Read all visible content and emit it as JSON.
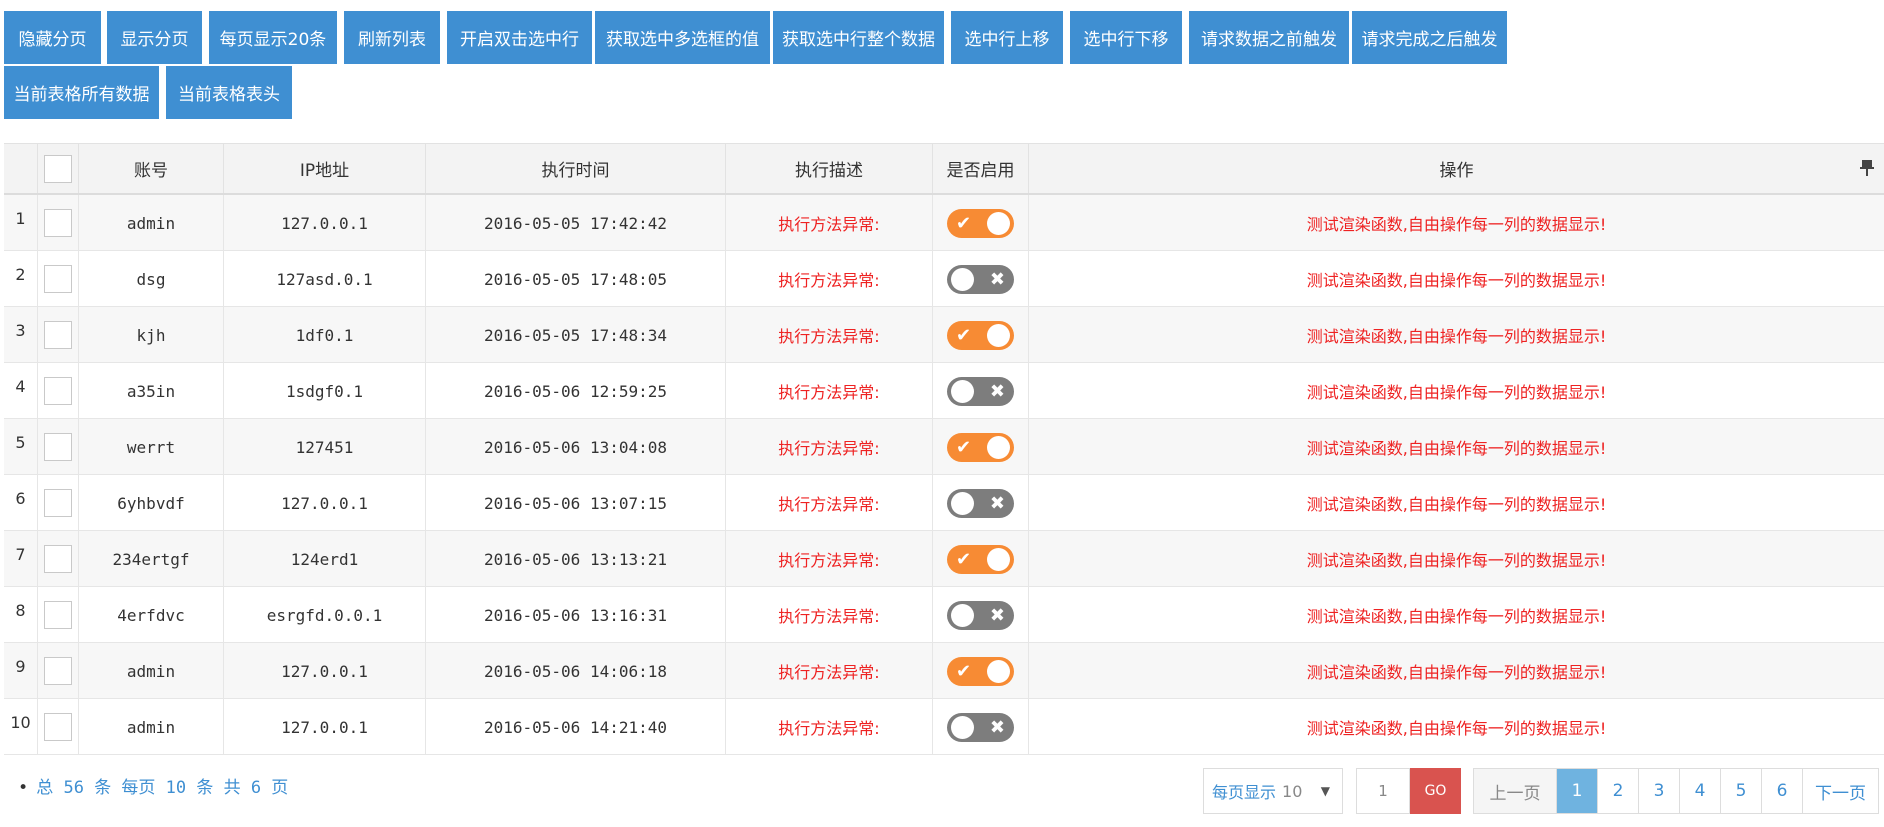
{
  "toolbar": {
    "buttons": [
      "隐藏分页",
      "显示分页",
      "每页显示20条",
      "刷新列表",
      "开启双击选中行",
      "获取选中多选框的值",
      "获取选中行整个数据",
      "选中行上移",
      "选中行下移",
      "请求数据之前触发",
      "请求完成之后触发",
      "当前表格所有数据",
      "当前表格表头"
    ]
  },
  "table": {
    "headers": [
      "账号",
      "IP地址",
      "执行时间",
      "执行描述",
      "是否启用",
      "操作"
    ],
    "rows": [
      {
        "index": "1",
        "account": "admin",
        "ip": "127.0.0.1",
        "time": "2016-05-05 17:42:42",
        "desc": "执行方法异常:",
        "enabled": true,
        "op": "测试渲染函数,自由操作每一列的数据显示!"
      },
      {
        "index": "2",
        "account": "dsg",
        "ip": "127asd.0.1",
        "time": "2016-05-05 17:48:05",
        "desc": "执行方法异常:",
        "enabled": false,
        "op": "测试渲染函数,自由操作每一列的数据显示!"
      },
      {
        "index": "3",
        "account": "kjh",
        "ip": "1df0.1",
        "time": "2016-05-05 17:48:34",
        "desc": "执行方法异常:",
        "enabled": true,
        "op": "测试渲染函数,自由操作每一列的数据显示!"
      },
      {
        "index": "4",
        "account": "a35in",
        "ip": "1sdgf0.1",
        "time": "2016-05-06 12:59:25",
        "desc": "执行方法异常:",
        "enabled": false,
        "op": "测试渲染函数,自由操作每一列的数据显示!"
      },
      {
        "index": "5",
        "account": "werrt",
        "ip": "127451",
        "time": "2016-05-06 13:04:08",
        "desc": "执行方法异常:",
        "enabled": true,
        "op": "测试渲染函数,自由操作每一列的数据显示!"
      },
      {
        "index": "6",
        "account": "6yhbvdf",
        "ip": "127.0.0.1",
        "time": "2016-05-06 13:07:15",
        "desc": "执行方法异常:",
        "enabled": false,
        "op": "测试渲染函数,自由操作每一列的数据显示!"
      },
      {
        "index": "7",
        "account": "234ertgf",
        "ip": "124erd1",
        "time": "2016-05-06 13:13:21",
        "desc": "执行方法异常:",
        "enabled": true,
        "op": "测试渲染函数,自由操作每一列的数据显示!"
      },
      {
        "index": "8",
        "account": "4erfdvc",
        "ip": "esrgfd.0.0.1",
        "time": "2016-05-06 13:16:31",
        "desc": "执行方法异常:",
        "enabled": false,
        "op": "测试渲染函数,自由操作每一列的数据显示!"
      },
      {
        "index": "9",
        "account": "admin",
        "ip": "127.0.0.1",
        "time": "2016-05-06 14:06:18",
        "desc": "执行方法异常:",
        "enabled": true,
        "op": "测试渲染函数,自由操作每一列的数据显示!"
      },
      {
        "index": "10",
        "account": "admin",
        "ip": "127.0.0.1",
        "time": "2016-05-06 14:21:40",
        "desc": "执行方法异常:",
        "enabled": false,
        "op": "测试渲染函数,自由操作每一列的数据显示!"
      }
    ]
  },
  "icons": {
    "pin": "pin-icon",
    "check": "✔",
    "cross": "✖",
    "dropdown": "▼"
  },
  "colors": {
    "button_bg": "#3f8fd2",
    "switch_on": "#f78b34",
    "switch_off": "#7d7d7d",
    "error_text": "#ee2222",
    "go_button": "#d9534f",
    "active_page": "#6fb3e0"
  },
  "footer": {
    "summary": "总 56 条 每页 10 条 共 6 页",
    "page_size_label": "每页显示",
    "page_size_value": "10",
    "jump_value": "1",
    "go_label": "GO",
    "prev_label": "上一页",
    "next_label": "下一页",
    "pages": [
      "1",
      "2",
      "3",
      "4",
      "5",
      "6"
    ],
    "current_page": "1"
  }
}
